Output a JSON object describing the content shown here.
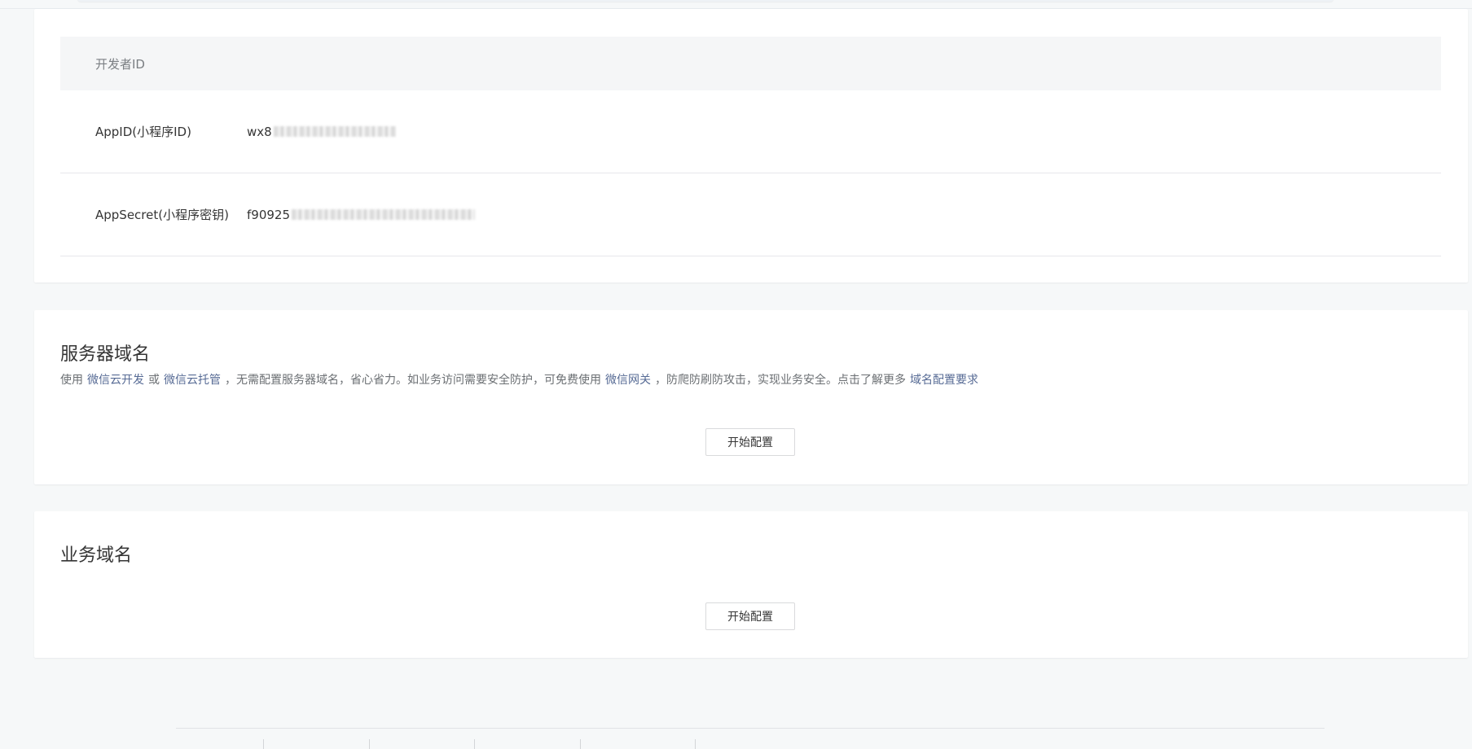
{
  "developer_id": {
    "header": "开发者ID",
    "rows": [
      {
        "label": "AppID(小程序ID)",
        "value_visible": "wx8"
      },
      {
        "label": "AppSecret(小程序密钥)",
        "value_visible": "f90925"
      }
    ]
  },
  "server_domain": {
    "title": "服务器域名",
    "desc": {
      "part1": "使用",
      "link1": "微信云开发",
      "part2": "或",
      "link2": "微信云托管",
      "part3": "，无需配置服务器域名，省心省力。如业务访问需要安全防护，可免费使用",
      "link3": "微信网关",
      "part4": "，防爬防刷防攻击，实现业务安全。点击了解更多",
      "link4": "域名配置要求"
    },
    "button_label": "开始配置"
  },
  "business_domain": {
    "title": "业务域名",
    "button_label": "开始配置"
  },
  "colors": {
    "link": "#576b95",
    "page_bg": "#f6f8f9",
    "card_bg": "#ffffff",
    "table_header_bg": "#f5f6f7"
  }
}
